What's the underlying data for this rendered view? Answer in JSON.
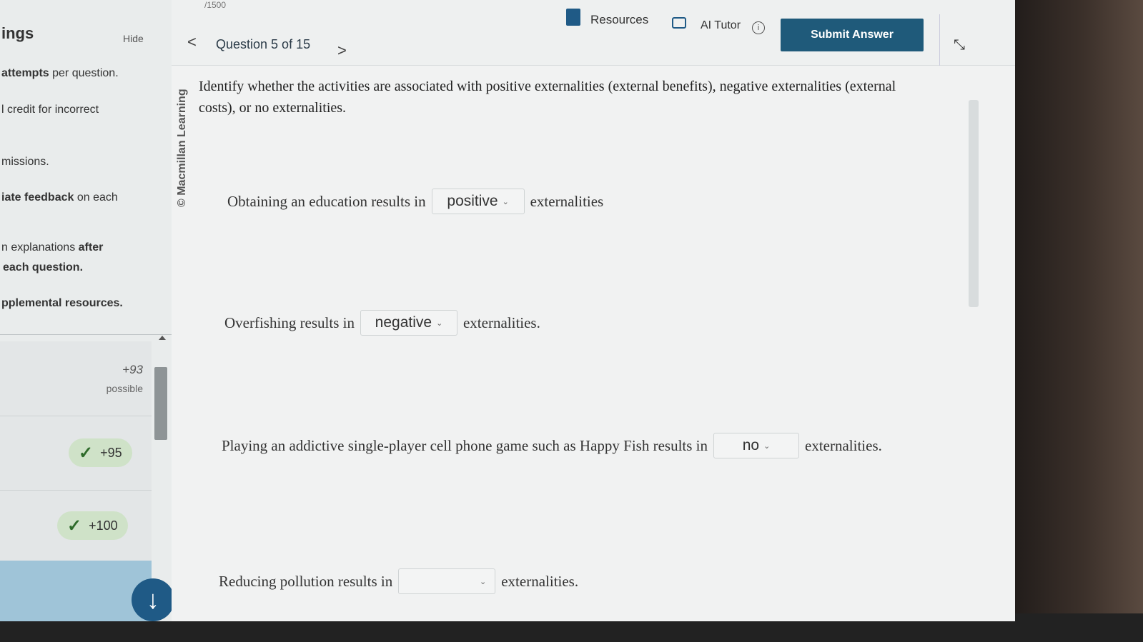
{
  "sidebar": {
    "title": "ings",
    "hide_label": "Hide",
    "lines": [
      {
        "bold": "attempts",
        "text": " per question."
      },
      {
        "bold": "",
        "text": "l credit for incorrect"
      },
      {
        "bold": "",
        "text": "missions."
      },
      {
        "bold": "iate feedback",
        "text": " on each"
      },
      {
        "bold": "after",
        "text": "n explanations "
      },
      {
        "bold": "each question.",
        "text": ""
      },
      {
        "bold": "pplemental resources.",
        "text": ""
      }
    ],
    "points_possible_value": "+93",
    "points_possible_label": "possible",
    "badges": [
      {
        "check": "✓",
        "value": "+95"
      },
      {
        "check": "✓",
        "value": "+100"
      }
    ],
    "down_arrow": "↓"
  },
  "header": {
    "points_total": "/1500",
    "prev": "<",
    "next": ">",
    "question_label": "Question 5 of 15",
    "resources_label": "Resources",
    "ai_tutor_label": "AI Tutor",
    "info_icon": "i",
    "submit_label": "Submit Answer",
    "collapse_icon": "⤡"
  },
  "copyright": "© Macmillan Learning",
  "prompt": "Identify whether the activities are associated with positive externalities (external benefits), negative externalities (external costs), or no externalities.",
  "rows": [
    {
      "pre": "Obtaining an education results in",
      "selected": "positive",
      "post": "externalities"
    },
    {
      "pre": "Overfishing results in",
      "selected": "negative",
      "post": "externalities."
    },
    {
      "pre": "Playing an addictive single-player cell phone game such as Happy Fish results in",
      "selected": "no",
      "post": "externalities."
    },
    {
      "pre": "Reducing pollution results in",
      "selected": "",
      "post": "externalities."
    }
  ],
  "caret": "⌄",
  "colors": {
    "accent": "#1f5a7a",
    "badge": "#cfe2c8",
    "check": "#2e6b2a"
  }
}
